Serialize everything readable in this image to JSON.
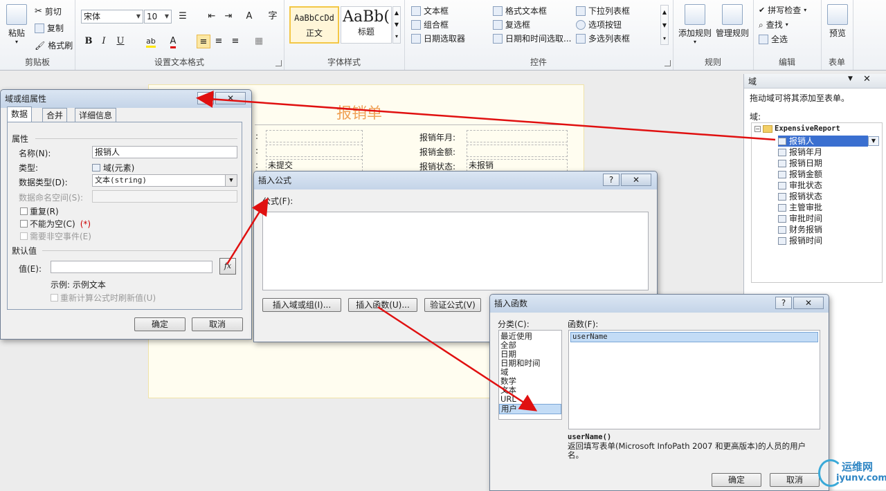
{
  "ribbon": {
    "clipboard": {
      "label": "剪贴板",
      "paste": "粘贴",
      "cut": "剪切",
      "copy": "复制",
      "format_painter": "格式刷"
    },
    "font": {
      "label": "设置文本格式",
      "font_name": "宋体",
      "font_size": "10",
      "bold": "B",
      "italic": "I",
      "underline": "U",
      "char_glyph": "字"
    },
    "styles": {
      "label": "字体样式",
      "normal_preview": "AaBbCcDd",
      "normal": "正文",
      "heading_preview": "AaBb(",
      "heading": "标题"
    },
    "controls": {
      "label": "控件",
      "items": [
        "文本框",
        "格式文本框",
        "下拉列表框",
        "组合框",
        "复选框",
        "选项按钮",
        "日期选取器",
        "日期和时间选取...",
        "多选列表框"
      ]
    },
    "rules": {
      "label": "规则",
      "add_rule": "添加规则",
      "manage_rules": "管理规则"
    },
    "editing": {
      "label": "编辑",
      "spell_check": "拼写检查",
      "find": "查找",
      "select_all": "全选"
    },
    "form": {
      "label": "表单",
      "preview": "预览"
    }
  },
  "form": {
    "title": "报销单",
    "labels": [
      "报销年月:",
      "报销金额:",
      "报销状态:"
    ],
    "values": [
      "未提交",
      "未报销"
    ],
    "colons": [
      ":",
      ":",
      ":"
    ]
  },
  "taskpane": {
    "title": "域",
    "hint": "拖动域可将其添加至表单。",
    "fields_label": "域:",
    "root": "ExpensiveReport",
    "items": [
      "报销人",
      "报销年月",
      "报销日期",
      "报销金额",
      "审批状态",
      "报销状态",
      "主管审批",
      "审批时间",
      "财务报销",
      "报销时间"
    ]
  },
  "field_props": {
    "title": "域或组属性",
    "help": "?",
    "close": "✕",
    "tabs": [
      "数据",
      "合并",
      "详细信息"
    ],
    "section_props": "属性",
    "name_label": "名称(N):",
    "name_value": "报销人",
    "type_label": "类型:",
    "type_value": "域(元素)",
    "datatype_label": "数据类型(D):",
    "datatype_value": "文本(string)",
    "namespace_label": "数据命名空间(S):",
    "repeat": "重复(R)",
    "not_empty": "不能为空(C)",
    "not_empty_mark": "(*)",
    "need_event": "需要非空事件(E)",
    "section_default": "默认值",
    "value_label": "值(E):",
    "fx": "fx",
    "example": "示例: 示例文本",
    "recalc": "重新计算公式时刷新值(U)",
    "ok": "确定",
    "cancel": "取消"
  },
  "insert_formula": {
    "title": "插入公式",
    "help": "?",
    "close": "✕",
    "formula_label": "公式(F):",
    "insert_field": "插入域或组(I)...",
    "insert_function": "插入函数(U)...",
    "verify": "验证公式(V)"
  },
  "insert_function": {
    "title": "插入函数",
    "help": "?",
    "close": "✕",
    "category_label": "分类(C):",
    "categories": [
      "最近使用",
      "全部",
      "日期",
      "日期和时间",
      "域",
      "数学",
      "文本",
      "URL",
      "用户"
    ],
    "selected_category": "用户",
    "function_label": "函数(F):",
    "functions": [
      "userName"
    ],
    "signature": "userName()",
    "description": "返回填写表单(Microsoft InfoPath 2007 和更高版本)的人员的用户名。",
    "ok": "确定",
    "cancel": "取消"
  },
  "watermark": {
    "text": "运维网",
    "url": "iyunv.com"
  },
  "colors": {
    "arrow": "#e01010",
    "title_orange": "#f0a257",
    "selection": "#c3dcf6"
  }
}
